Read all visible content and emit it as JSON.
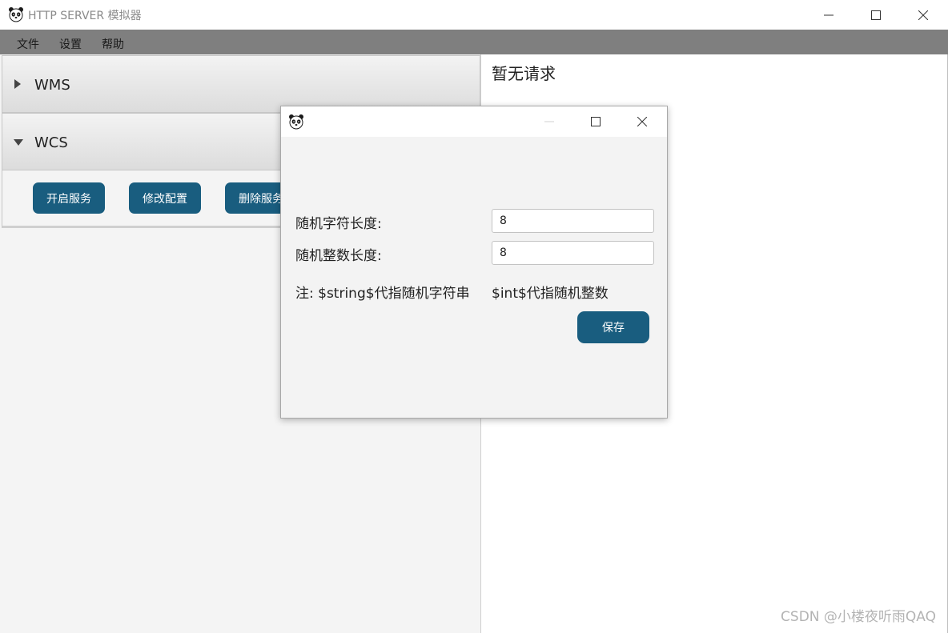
{
  "window": {
    "title": "HTTP SERVER 模拟器",
    "icon": "panda-icon",
    "controls": {
      "minimize": "minimize-icon",
      "maximize": "maximize-icon",
      "close": "close-icon"
    }
  },
  "menubar": {
    "items": [
      {
        "label": "文件"
      },
      {
        "label": "设置"
      },
      {
        "label": "帮助"
      }
    ]
  },
  "accordion": {
    "panels": [
      {
        "label": "WMS",
        "expanded": false
      },
      {
        "label": "WCS",
        "expanded": true
      }
    ],
    "wcs_buttons": [
      {
        "label": "开启服务"
      },
      {
        "label": "修改配置"
      },
      {
        "label": "删除服务"
      }
    ]
  },
  "right_panel": {
    "empty_text": "暂无请求",
    "watermark": "CSDN @小楼夜听雨QAQ"
  },
  "dialog": {
    "icon": "panda-icon",
    "string_length_label": "随机字符长度:",
    "string_length_value": "8",
    "int_length_label": "随机整数长度:",
    "int_length_value": "8",
    "note_string": "注: $string$代指随机字符串",
    "note_int": "$int$代指随机整数",
    "save_label": "保存"
  },
  "colors": {
    "accent_button": "#195d7f",
    "menubar_bg": "#7f7f7f",
    "panel_bg": "#f4f4f4"
  }
}
